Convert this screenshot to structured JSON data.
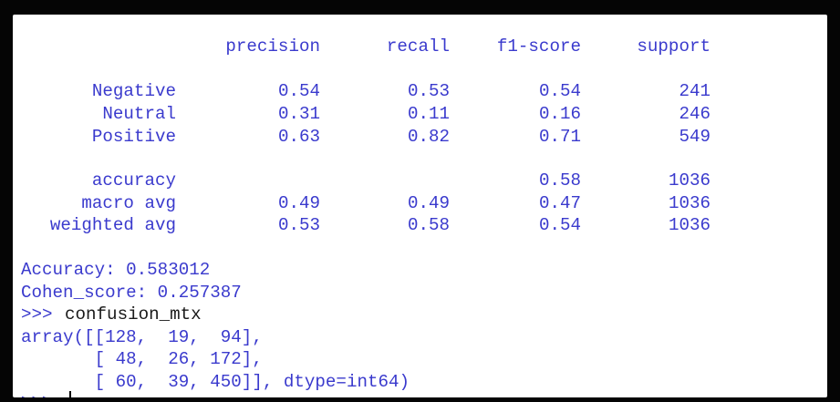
{
  "report": {
    "header": [
      "precision",
      "recall",
      "f1-score",
      "support"
    ],
    "class_rows": [
      {
        "label": "Negative",
        "precision": "0.54",
        "recall": "0.53",
        "f1": "0.54",
        "support": "241"
      },
      {
        "label": "Neutral",
        "precision": "0.31",
        "recall": "0.11",
        "f1": "0.16",
        "support": "246"
      },
      {
        "label": "Positive",
        "precision": "0.63",
        "recall": "0.82",
        "f1": "0.71",
        "support": "549"
      }
    ],
    "summary_rows": [
      {
        "label": "accuracy",
        "precision": "",
        "recall": "",
        "f1": "0.58",
        "support": "1036"
      },
      {
        "label": "macro avg",
        "precision": "0.49",
        "recall": "0.49",
        "f1": "0.47",
        "support": "1036"
      },
      {
        "label": "weighted avg",
        "precision": "0.53",
        "recall": "0.58",
        "f1": "0.54",
        "support": "1036"
      }
    ]
  },
  "output": {
    "accuracy_line": "Accuracy: 0.583012",
    "cohen_line": "Cohen_score: 0.257387"
  },
  "session": {
    "prompt": ">>>",
    "command": "confusion_mtx",
    "array_lines": [
      "array([[128,  19,  94],",
      "       [ 48,  26, 172],",
      "       [ 60,  39, 450]], dtype=int64)"
    ],
    "next_prompt": ">>>"
  },
  "colors": {
    "output_text": "#3a3acd",
    "input_text": "#1a1a1a",
    "background": "#ffffff",
    "frame": "#050505"
  }
}
